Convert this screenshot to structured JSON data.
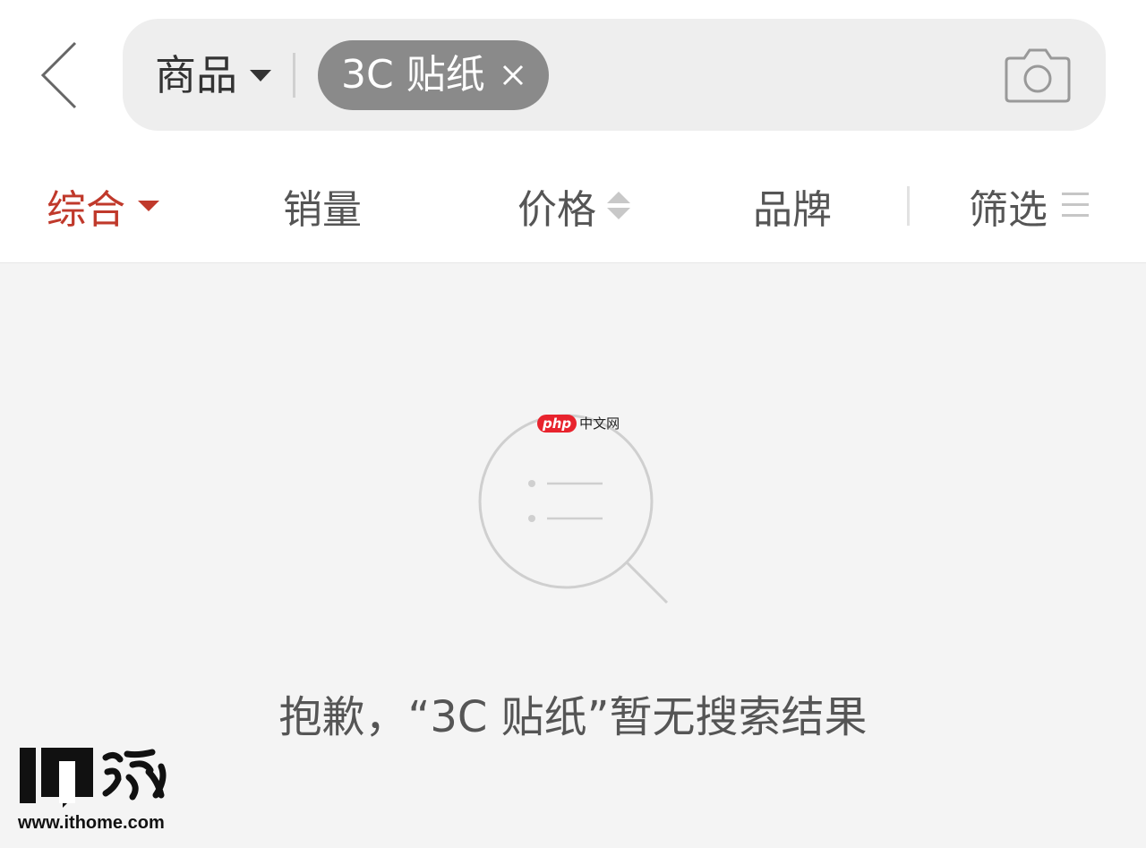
{
  "search": {
    "scope_label": "商品",
    "tag_label": "3C 贴纸"
  },
  "filters": [
    {
      "label": "综合",
      "active": true
    },
    {
      "label": "销量"
    },
    {
      "label": "价格"
    },
    {
      "label": "品牌"
    },
    {
      "label": "筛选"
    }
  ],
  "empty_state": {
    "message": "抱歉，“3C 贴纸”暂无搜索结果"
  },
  "watermarks": {
    "php_badge": "php",
    "php_site": "中文网",
    "ithome_logo_text": "IT之家",
    "ithome_url": "www.ithome.com"
  },
  "colors": {
    "accent": "#c0392b",
    "tag_bg": "#8a8a8a",
    "page_bg": "#f4f4f4"
  },
  "icons": [
    "back-arrow-icon",
    "caret-down-icon",
    "close-icon",
    "camera-icon",
    "sort-arrows-icon",
    "menu-lines-icon",
    "empty-search-icon"
  ]
}
